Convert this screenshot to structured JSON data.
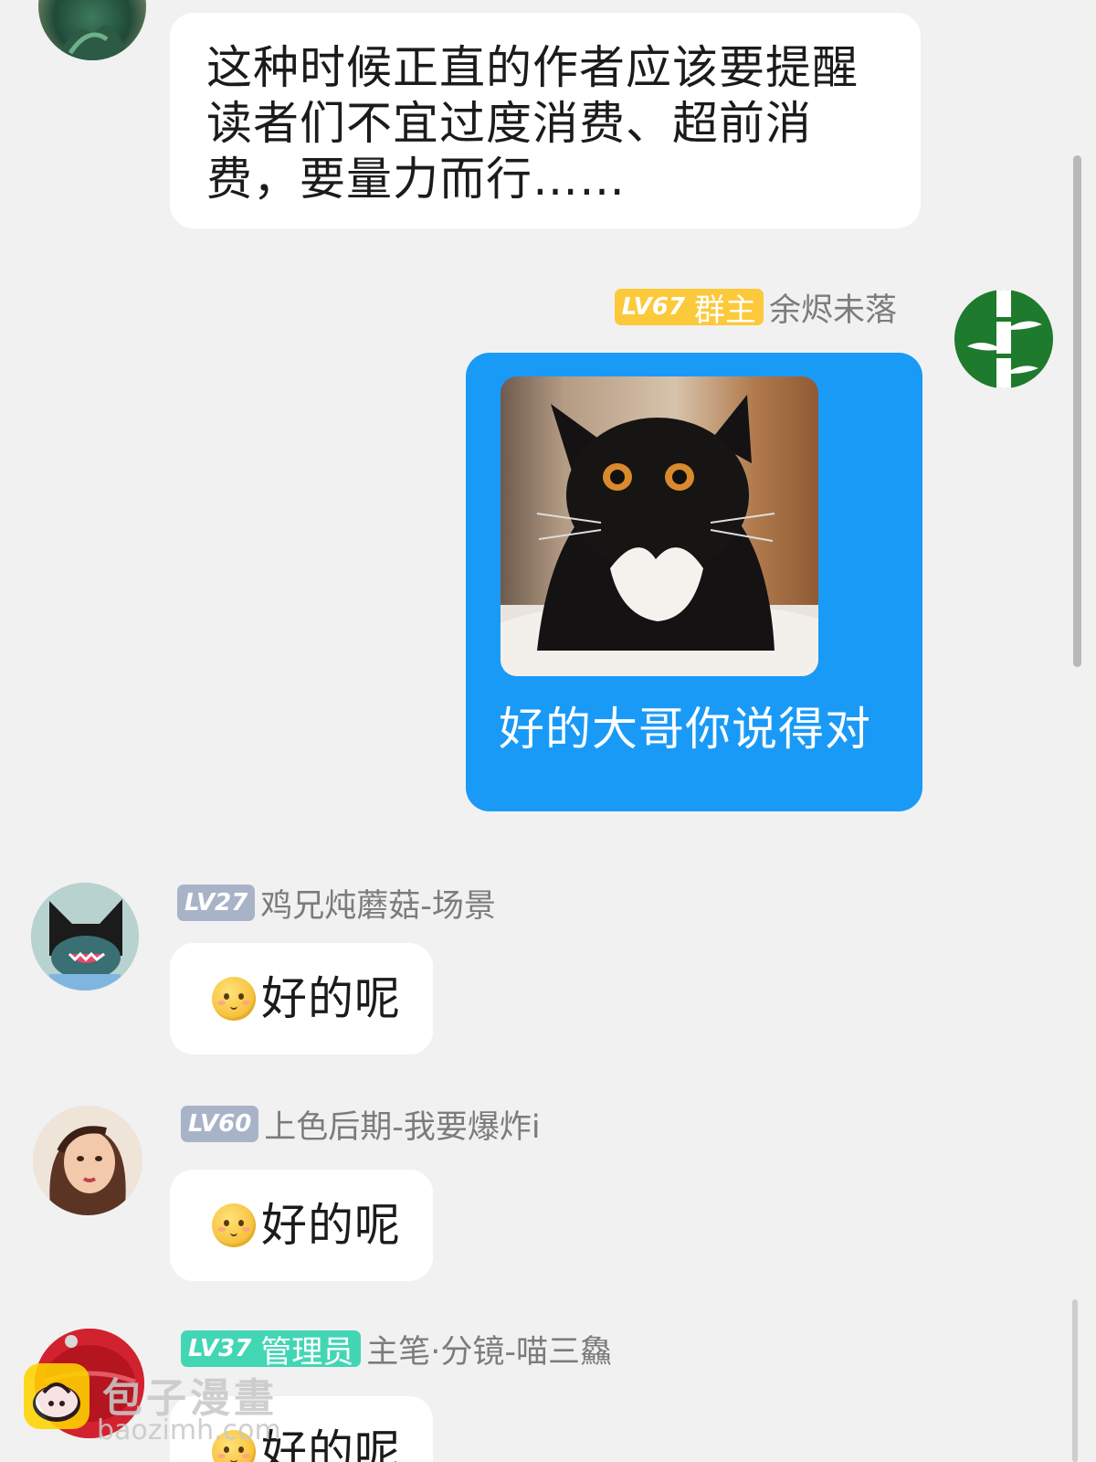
{
  "messages": [
    {
      "text_lines": [
        "这种时候正直的作者应该要提醒",
        "读者们不宜过度消费、超前消",
        "费，要量力而行……"
      ]
    },
    {
      "level": "LV67",
      "role": "群主",
      "nickname": "余烬未落",
      "caption": "好的大哥你说得对"
    },
    {
      "level": "LV27",
      "nickname": "鸡兄炖蘑菇-场景",
      "text": "好的呢"
    },
    {
      "level": "LV60",
      "nickname": "上色后期-我要爆炸i",
      "text": "好的呢"
    },
    {
      "level": "LV37",
      "role": "管理员",
      "nickname": "主笔·分镜-喵三鱻",
      "text": "好的呢"
    }
  ],
  "icons": {
    "reaction_emoji": "smiling-face-emoji-icon"
  },
  "colors": {
    "background": "#f1f1f1",
    "own_bubble": "#1a9af7",
    "owner_badge": "#fbc93a",
    "member_badge": "#a9b3c8",
    "admin_badge": "#43d6b4",
    "nickname_text": "#7c7c7c"
  },
  "watermark": {
    "name": "包子漫畫",
    "url": "baozimh.com"
  }
}
